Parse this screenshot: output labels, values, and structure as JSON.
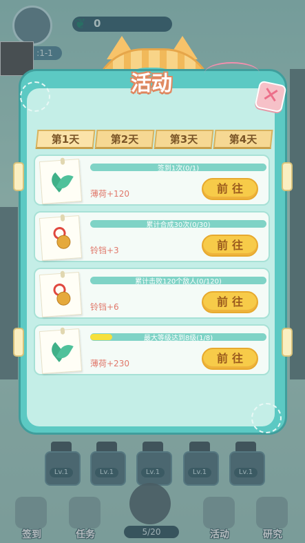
{
  "hud": {
    "currency_value": "0",
    "level": ":1-1"
  },
  "modal": {
    "title": "活动",
    "tabs": [
      {
        "label": "第1天",
        "active": true
      },
      {
        "label": "第2天",
        "active": false
      },
      {
        "label": "第3天",
        "active": false
      },
      {
        "label": "第4天",
        "active": false
      }
    ],
    "tasks": [
      {
        "icon": "mint-leaf-icon",
        "progress_text": "签到1次(0/1)",
        "progress": 0.0,
        "reward": "薄荷+120",
        "button": "前往"
      },
      {
        "icon": "bell-icon",
        "progress_text": "累计合成30次(0/30)",
        "progress": 0.0,
        "reward": "铃铛+3",
        "button": "前往"
      },
      {
        "icon": "bell-icon",
        "progress_text": "累计击败120个敌人(0/120)",
        "progress": 0.0,
        "reward": "铃铛+6",
        "button": "前往"
      },
      {
        "icon": "mint-leaf-icon",
        "progress_text": "最大等级达到8级(1/8)",
        "progress": 0.125,
        "reward": "薄荷+230",
        "button": "前往"
      }
    ]
  },
  "turrets": [
    {
      "level": "Lv.1"
    },
    {
      "level": "Lv.1"
    },
    {
      "level": "Lv.1"
    },
    {
      "level": "Lv.1"
    },
    {
      "level": "Lv.1"
    }
  ],
  "bottom_nav": {
    "items": [
      {
        "label": "签到"
      },
      {
        "label": "任务"
      },
      {
        "label": "活动"
      },
      {
        "label": "研究"
      }
    ],
    "progress": "5/20"
  },
  "colors": {
    "modal_teal": "#5cc9c3",
    "button_yellow": "#f7cb49",
    "reward_red": "#e0776a",
    "title_orange": "#e18a62"
  }
}
